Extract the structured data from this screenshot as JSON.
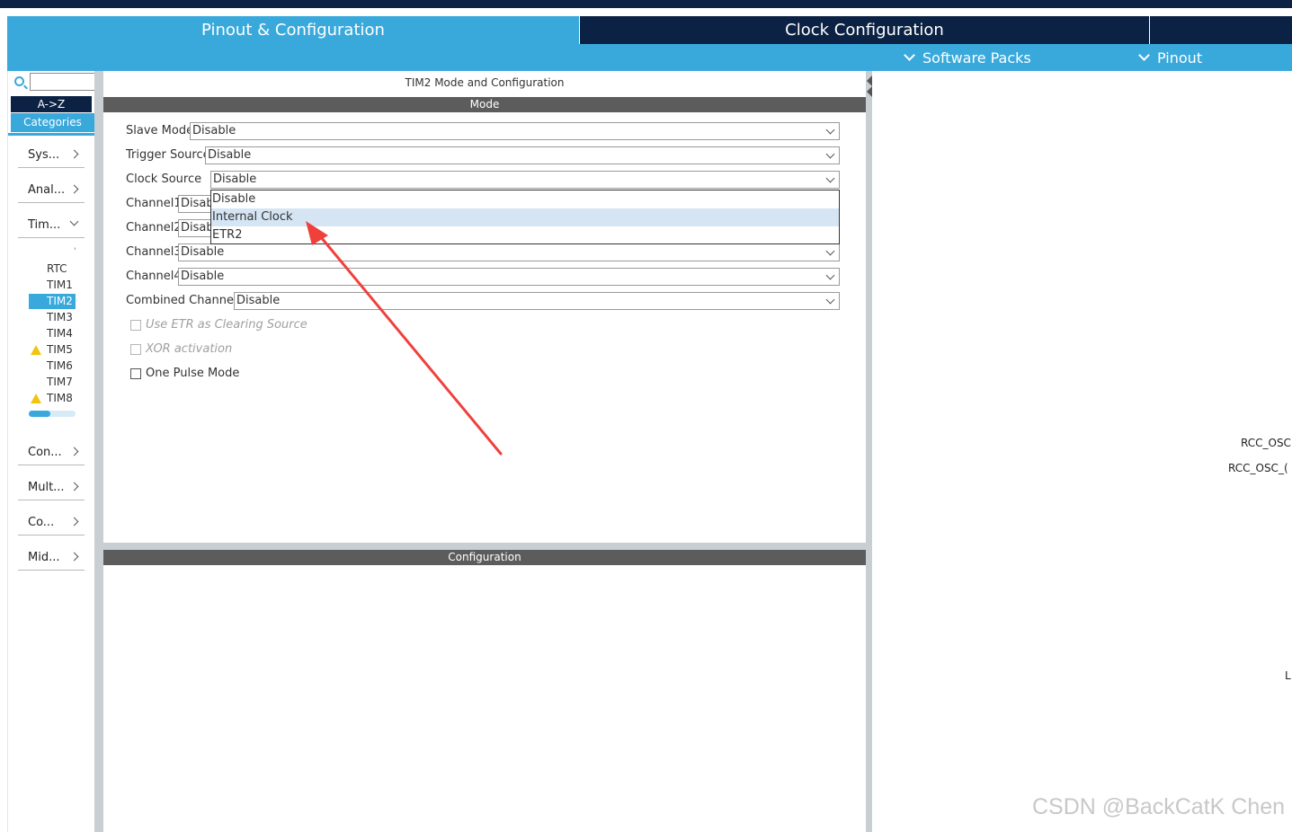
{
  "tabs": [
    {
      "label": "Pinout & Configuration",
      "active": true
    },
    {
      "label": "Clock Configuration",
      "active": false
    }
  ],
  "subbar": {
    "software_packs": "Software Packs",
    "pinout": "Pinout"
  },
  "sidebar": {
    "search_value": "",
    "az_label": "A->Z",
    "categories_label": "Categories",
    "categories": [
      {
        "label": "Sys...",
        "expanded": false
      },
      {
        "label": "Anal...",
        "expanded": false
      },
      {
        "label": "Tim...",
        "expanded": true
      },
      {
        "label": "Con...",
        "expanded": false
      },
      {
        "label": "Mult...",
        "expanded": false
      },
      {
        "label": "Co...",
        "expanded": false
      },
      {
        "label": "Mid...",
        "expanded": false
      }
    ],
    "peripherals": [
      {
        "label": "RTC",
        "warning": false
      },
      {
        "label": "TIM1",
        "warning": false
      },
      {
        "label": "TIM2",
        "warning": false,
        "selected": true
      },
      {
        "label": "TIM3",
        "warning": false
      },
      {
        "label": "TIM4",
        "warning": false
      },
      {
        "label": "TIM5",
        "warning": true
      },
      {
        "label": "TIM6",
        "warning": false
      },
      {
        "label": "TIM7",
        "warning": false
      },
      {
        "label": "TIM8",
        "warning": true
      }
    ],
    "tick_mark": "'"
  },
  "panel": {
    "title": "TIM2 Mode and Configuration",
    "mode_header": "Mode",
    "config_header": "Configuration",
    "fields": {
      "slave_mode": {
        "label": "Slave Mode",
        "value": "Disable"
      },
      "trigger_source": {
        "label": "Trigger Source",
        "value": "Disable"
      },
      "clock_source": {
        "label": "Clock Source",
        "value": "Disable"
      },
      "channel1": {
        "label": "Channel1",
        "value": "Disab"
      },
      "channel2": {
        "label": "Channel2",
        "value": "Disab"
      },
      "channel3": {
        "label": "Channel3",
        "value": "Disable"
      },
      "channel4": {
        "label": "Channel4",
        "value": "Disable"
      },
      "combined": {
        "label": "Combined Channels",
        "value": "Disable"
      }
    },
    "clock_source_options": [
      "Disable",
      "Internal Clock",
      "ETR2"
    ],
    "highlighted_option": "Internal Clock",
    "checkboxes": {
      "etr_clearing": {
        "label": "Use ETR as Clearing Source",
        "checked": false,
        "enabled": false
      },
      "xor": {
        "label": "XOR activation",
        "checked": false,
        "enabled": false
      },
      "one_pulse": {
        "label": "One Pulse Mode",
        "checked": false,
        "enabled": true
      }
    }
  },
  "pinout_view": {
    "labels": [
      "RCC_OSC",
      "RCC_OSC_(",
      "L"
    ]
  },
  "watermark": "CSDN @BackCatK Chen",
  "colors": {
    "accent": "#39a9dc",
    "navy": "#0b2244",
    "section_bar": "#5c5c5c",
    "highlight": "#d5e5f4",
    "annotation_arrow": "#f0403c",
    "warning": "#f1c40f"
  }
}
